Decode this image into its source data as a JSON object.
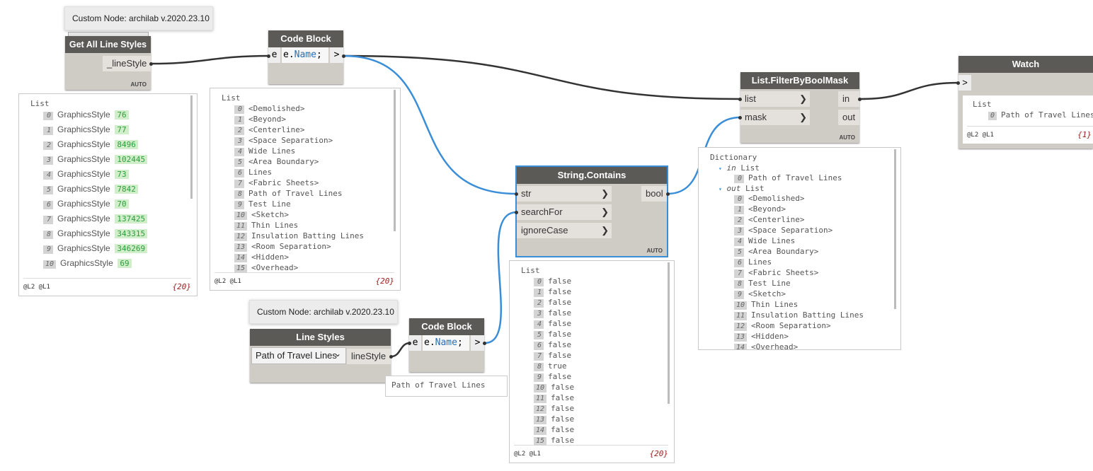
{
  "tooltips": {
    "custom1": "Custom Node: archilab v.2020.23.10",
    "custom2": "Custom Node: archilab v.2020.23.10"
  },
  "nodes": {
    "get_all": {
      "title": "Get All Line Styles",
      "out": "_lineStyle",
      "lacing": "AUTO"
    },
    "code1": {
      "title": "Code Block",
      "in": "e",
      "code_var": "e.",
      "code_prop": "Name",
      "code_end": ";",
      "out": ">"
    },
    "filter": {
      "title": "List.FilterByBoolMask",
      "in1": "list",
      "in2": "mask",
      "out1": "in",
      "out2": "out",
      "lacing": "AUTO",
      "arrow": "❯"
    },
    "watch": {
      "title": "Watch",
      "in": ">"
    },
    "contains": {
      "title": "String.Contains",
      "in1": "str",
      "in2": "searchFor",
      "in3": "ignoreCase",
      "out": "bool",
      "lacing": "AUTO",
      "arrow": "❯"
    },
    "line_styles": {
      "title": "Line Styles",
      "selected": "Path of Travel Lines",
      "chevron": "⌄",
      "out": "lineStyle"
    },
    "code2": {
      "title": "Code Block",
      "in": "e",
      "code_var": "e.",
      "code_prop": "Name",
      "code_end": ";",
      "out": ">"
    }
  },
  "previews": {
    "get_all": {
      "title": "List",
      "levels": "@L2 @L1",
      "count": "{20}",
      "rows": [
        {
          "i": "0",
          "t": "GraphicsStyle",
          "v": "76"
        },
        {
          "i": "1",
          "t": "GraphicsStyle",
          "v": "77"
        },
        {
          "i": "2",
          "t": "GraphicsStyle",
          "v": "8496"
        },
        {
          "i": "3",
          "t": "GraphicsStyle",
          "v": "102445"
        },
        {
          "i": "4",
          "t": "GraphicsStyle",
          "v": "73"
        },
        {
          "i": "5",
          "t": "GraphicsStyle",
          "v": "7842"
        },
        {
          "i": "6",
          "t": "GraphicsStyle",
          "v": "70"
        },
        {
          "i": "7",
          "t": "GraphicsStyle",
          "v": "137425"
        },
        {
          "i": "8",
          "t": "GraphicsStyle",
          "v": "343315"
        },
        {
          "i": "9",
          "t": "GraphicsStyle",
          "v": "346269"
        },
        {
          "i": "10",
          "t": "GraphicsStyle",
          "v": "69"
        }
      ]
    },
    "code1": {
      "title": "List",
      "levels": "@L2 @L1",
      "count": "{20}",
      "rows": [
        {
          "i": "0",
          "t": "<Demolished>"
        },
        {
          "i": "1",
          "t": "<Beyond>"
        },
        {
          "i": "2",
          "t": "<Centerline>"
        },
        {
          "i": "3",
          "t": "<Space Separation>"
        },
        {
          "i": "4",
          "t": "Wide Lines"
        },
        {
          "i": "5",
          "t": "<Area Boundary>"
        },
        {
          "i": "6",
          "t": "Lines"
        },
        {
          "i": "7",
          "t": "<Fabric Sheets>"
        },
        {
          "i": "8",
          "t": "Path of Travel Lines"
        },
        {
          "i": "9",
          "t": "Test Line"
        },
        {
          "i": "10",
          "t": "<Sketch>"
        },
        {
          "i": "11",
          "t": "Thin Lines"
        },
        {
          "i": "12",
          "t": "Insulation Batting Lines"
        },
        {
          "i": "13",
          "t": "<Room Separation>"
        },
        {
          "i": "14",
          "t": "<Hidden>"
        },
        {
          "i": "15",
          "t": "<Overhead>"
        }
      ]
    },
    "contains": {
      "title": "List",
      "levels": "@L2 @L1",
      "count": "{20}",
      "rows": [
        {
          "i": "0",
          "t": "false"
        },
        {
          "i": "1",
          "t": "false"
        },
        {
          "i": "2",
          "t": "false"
        },
        {
          "i": "3",
          "t": "false"
        },
        {
          "i": "4",
          "t": "false"
        },
        {
          "i": "5",
          "t": "false"
        },
        {
          "i": "6",
          "t": "false"
        },
        {
          "i": "7",
          "t": "false"
        },
        {
          "i": "8",
          "t": "true"
        },
        {
          "i": "9",
          "t": "false"
        },
        {
          "i": "10",
          "t": "false"
        },
        {
          "i": "11",
          "t": "false"
        },
        {
          "i": "12",
          "t": "false"
        },
        {
          "i": "13",
          "t": "false"
        },
        {
          "i": "14",
          "t": "false"
        },
        {
          "i": "15",
          "t": "false"
        }
      ]
    },
    "filter": {
      "title": "Dictionary",
      "in_key": "in",
      "in_label": "List",
      "in_rows": [
        {
          "i": "0",
          "t": "Path of Travel Lines"
        }
      ],
      "out_key": "out",
      "out_label": "List",
      "out_rows": [
        {
          "i": "0",
          "t": "<Demolished>"
        },
        {
          "i": "1",
          "t": "<Beyond>"
        },
        {
          "i": "2",
          "t": "<Centerline>"
        },
        {
          "i": "3",
          "t": "<Space Separation>"
        },
        {
          "i": "4",
          "t": "Wide Lines"
        },
        {
          "i": "5",
          "t": "<Area Boundary>"
        },
        {
          "i": "6",
          "t": "Lines"
        },
        {
          "i": "7",
          "t": "<Fabric Sheets>"
        },
        {
          "i": "8",
          "t": "Test Line"
        },
        {
          "i": "9",
          "t": "<Sketch>"
        },
        {
          "i": "10",
          "t": "Thin Lines"
        },
        {
          "i": "11",
          "t": "Insulation Batting Lines"
        },
        {
          "i": "12",
          "t": "<Room Separation>"
        },
        {
          "i": "13",
          "t": "<Hidden>"
        },
        {
          "i": "14",
          "t": "<Overhead>"
        }
      ]
    },
    "code2_value": "Path of Travel Lines",
    "watch": {
      "title": "List",
      "levels": "@L2 @L1",
      "count": "{1}",
      "rows": [
        {
          "i": "0",
          "t": "Path of Travel Lines"
        }
      ]
    }
  },
  "colors": {
    "wire": "#333333",
    "wire_selected": "#3a8ed8",
    "header": "#5c5a57"
  }
}
